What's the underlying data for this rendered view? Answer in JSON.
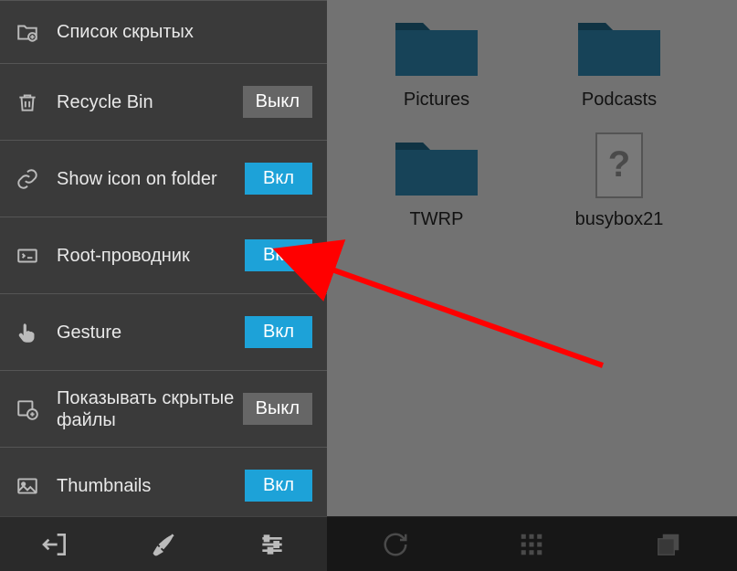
{
  "settings": [
    {
      "icon": "folder-plus-icon",
      "label": "Список скрытых",
      "toggle": null
    },
    {
      "icon": "trash-icon",
      "label": "Recycle Bin",
      "toggle": {
        "state": "off",
        "text": "Выкл"
      }
    },
    {
      "icon": "link-icon",
      "label": "Show icon on folder",
      "toggle": {
        "state": "on",
        "text": "Вкл"
      }
    },
    {
      "icon": "root-icon",
      "label": "Root-проводник",
      "toggle": {
        "state": "on",
        "text": "Вкл"
      }
    },
    {
      "icon": "gesture-icon",
      "label": "Gesture",
      "toggle": {
        "state": "on",
        "text": "Вкл"
      }
    },
    {
      "icon": "hidden-files-icon",
      "label": "Показывать скрытые файлы",
      "toggle": {
        "state": "off",
        "text": "Выкл"
      }
    },
    {
      "icon": "thumbnails-icon",
      "label": "Thumbnails",
      "toggle": {
        "state": "on",
        "text": "Вкл"
      }
    }
  ],
  "bottom_left": [
    "exit-icon",
    "brush-icon",
    "sliders-icon"
  ],
  "files": [
    {
      "type": "folder",
      "name": "Pictures"
    },
    {
      "type": "folder",
      "name": "Podcasts"
    },
    {
      "type": "folder",
      "name": "TWRP"
    },
    {
      "type": "unknown",
      "name": "busybox21"
    }
  ],
  "bottom_right": [
    "refresh-icon",
    "grid-icon",
    "windows-icon"
  ],
  "colors": {
    "accent": "#1da2d8",
    "arrow": "#ff0000"
  }
}
